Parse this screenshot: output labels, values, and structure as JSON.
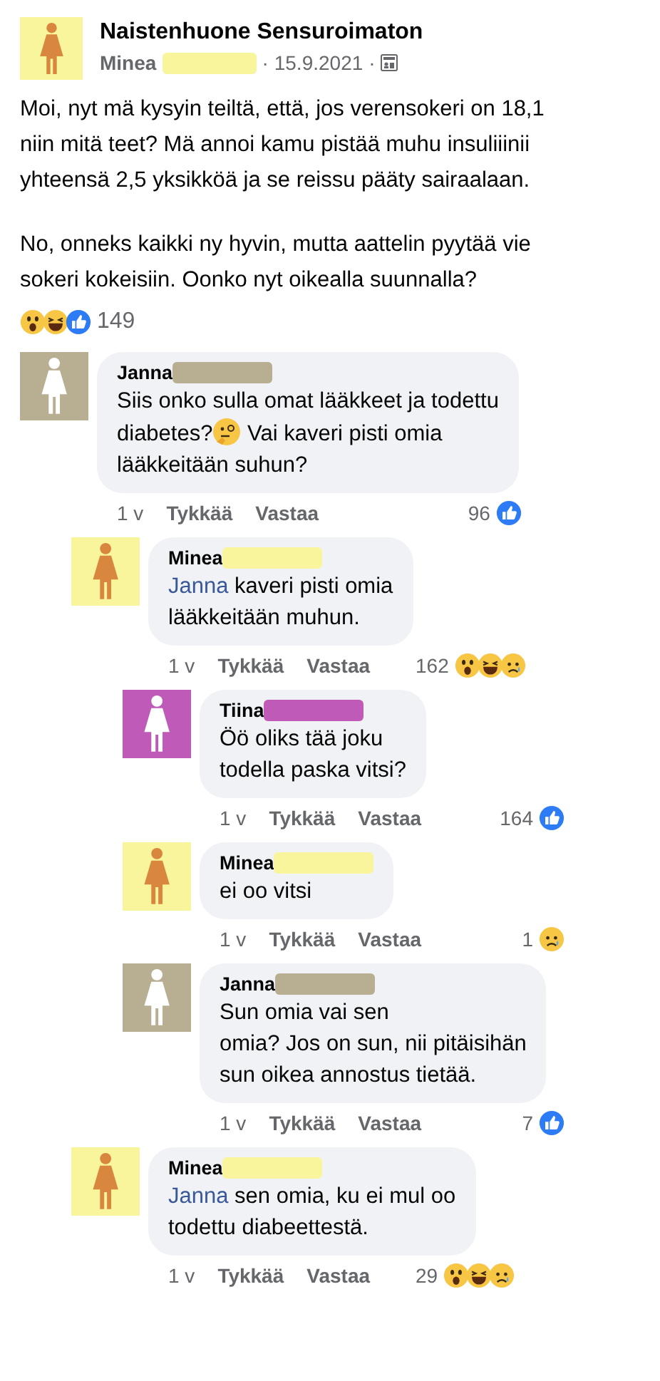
{
  "post": {
    "group": "Naistenhuone Sensuroimaton",
    "author": "Minea",
    "color": "#f8f59c",
    "date": "15.9.2021",
    "separator": "·",
    "body": [
      "Moi, nyt mä kysyin teiltä, että, jos verensokeri on 18,1\nniin mitä teet? Mä annoi kamu pistää muhu insuliiinii\nyhteensä 2,5 yksikköä ja se reissu pääty sairaalaan.",
      "No, onneks kaikki ny hyvin, mutta aattelin pyytää vie\nsokeri kokeisiin. Oonko nyt oikealla suunnalla?"
    ],
    "reactions": [
      {
        "kind": "wow"
      },
      {
        "kind": "haha"
      },
      {
        "kind": "like"
      }
    ],
    "reaction_count": "149"
  },
  "comments": [
    {
      "author": "Janna",
      "color": "#b8ae92",
      "text": "Siis onko sulla omat lääkkeet ja todettu\ndiabetes?",
      "emoji": {
        "kind": "thinking"
      },
      "text_after": " Vai kaveri pisti omia\nlääkkeitään suhun?",
      "time": "1 v",
      "like": "Tykkää",
      "reply": "Vastaa",
      "count": "96",
      "reactions": [
        {
          "kind": "like"
        }
      ],
      "children": [
        {
          "author": "Minea",
          "color": "#f8f59c",
          "mention": "Janna",
          "text": " kaveri pisti omia\nlääkkeitään muhun.",
          "time": "1 v",
          "like": "Tykkää",
          "reply": "Vastaa",
          "count": "162",
          "reactions": [
            {
              "kind": "wow"
            },
            {
              "kind": "haha"
            },
            {
              "kind": "sad"
            }
          ],
          "children": [
            {
              "author": "Tiina",
              "color": "#c05ab8",
              "text": "Öö oliks tää joku\ntodella paska vitsi?",
              "time": "1 v",
              "like": "Tykkää",
              "reply": "Vastaa",
              "count": "164",
              "reactions": [
                {
                  "kind": "like"
                }
              ]
            },
            {
              "author": "Minea",
              "color": "#f8f59c",
              "text": "ei oo vitsi",
              "time": "1 v",
              "like": "Tykkää",
              "reply": "Vastaa",
              "count": "1",
              "reactions": [
                {
                  "kind": "sad"
                }
              ]
            },
            {
              "author": "Janna",
              "color": "#b8ae92",
              "text": "Sun omia vai sen\nomia? Jos on sun, nii pitäisihän\nsun oikea annostus tietää.",
              "time": "1 v",
              "like": "Tykkää",
              "reply": "Vastaa",
              "count": "7",
              "reactions": [
                {
                  "kind": "like"
                }
              ]
            }
          ]
        },
        {
          "author": "Minea",
          "color": "#f8f59c",
          "mention": "Janna",
          "text": " sen omia, ku ei mul oo\ntodettu diabeettestä.",
          "time": "1 v",
          "like": "Tykkää",
          "reply": "Vastaa",
          "count": "29",
          "reactions": [
            {
              "kind": "wow"
            },
            {
              "kind": "haha"
            },
            {
              "kind": "sad"
            }
          ]
        }
      ]
    }
  ]
}
